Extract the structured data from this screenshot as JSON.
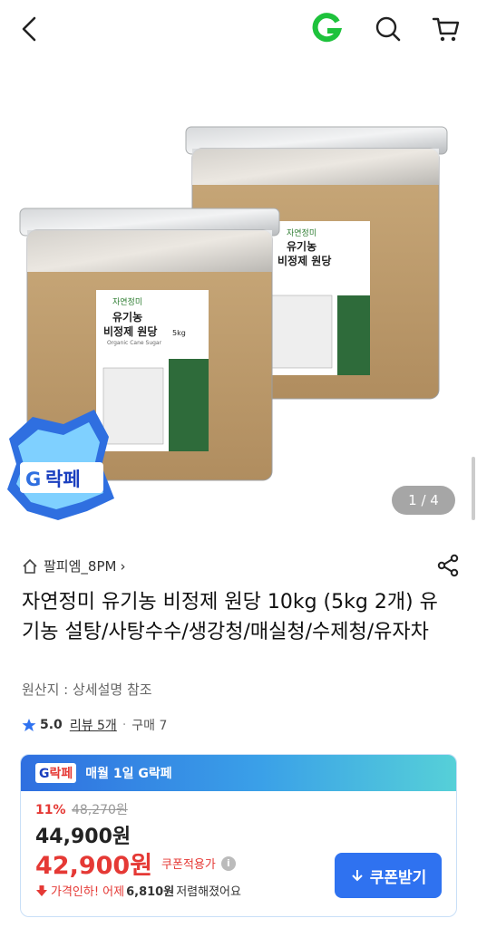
{
  "header": {
    "back_icon": "chevron-left-icon",
    "logo_letter": "G",
    "logo_color": "#1ec23c",
    "search_icon": "search-icon",
    "cart_icon": "cart-icon"
  },
  "gallery": {
    "package_brand": "자연정미",
    "package_title_line1": "유기농",
    "package_title_line2": "비정제 원당",
    "package_weight": "5kg",
    "package_subtitle": "Organic Cane Sugar",
    "sticker_text_g": "G",
    "sticker_text_rest": "락페",
    "indicator": "1 / 4"
  },
  "product": {
    "seller": "팔피엠_8PM",
    "seller_chevron": "›",
    "title": "자연정미 유기농 비정제 원당 10kg (5kg 2개) 유기농 설탕/사탕수수/생강청/매실청/수제청/유자차",
    "origin": "원산지 : 상세설명 참조",
    "rating": "5.0",
    "reviews": "리뷰 5개",
    "dot": "·",
    "purchases": "구매 7"
  },
  "promo": {
    "badge_g": "G",
    "badge_rest": "락페",
    "header_text": "매월 1일 G락페",
    "discount_rate": "11%",
    "original_price": "48,270원",
    "price": "44,900원",
    "coupon_price": "42,900원",
    "coupon_label": "쿠폰적용가",
    "info_glyph": "i",
    "drop_prefix": "가격인하! 어제",
    "drop_amount": "6,810원",
    "drop_suffix": "저렴해졌어요",
    "coupon_button": "쿠폰받기",
    "accent_color": "#2f72f0",
    "sale_color": "#e53935"
  }
}
